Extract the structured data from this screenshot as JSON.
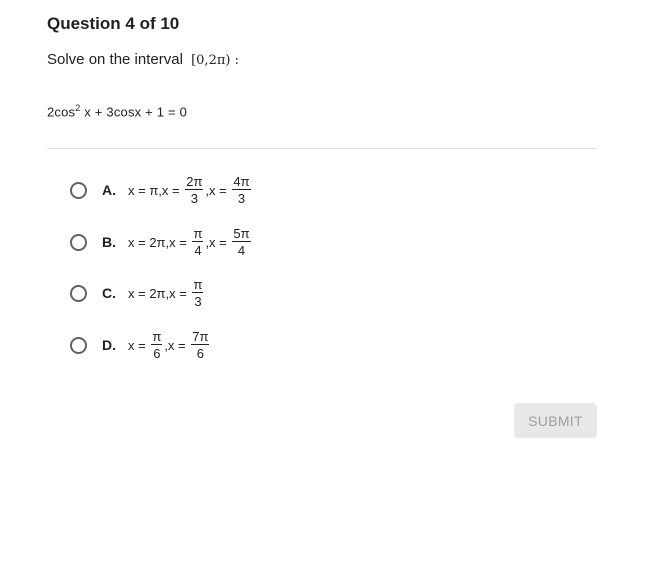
{
  "header": {
    "title": "Question 4 of 10"
  },
  "question": {
    "prompt": "Solve on the interval",
    "interval": "[0,2π) :",
    "equation_part1": "2cos",
    "equation_exp": "2",
    "equation_part2": " x + 3cosx + 1 = 0"
  },
  "options": {
    "a": {
      "letter": "A.",
      "t1": "x = π,x = ",
      "f1_num": "2π",
      "f1_den": "3",
      "t2": ",x = ",
      "f2_num": "4π",
      "f2_den": "3"
    },
    "b": {
      "letter": "B.",
      "t1": "x = 2π,x = ",
      "f1_num": "π",
      "f1_den": "4",
      "t2": ",x = ",
      "f2_num": "5π",
      "f2_den": "4"
    },
    "c": {
      "letter": "C.",
      "t1": "x = 2π,x = ",
      "f1_num": "π",
      "f1_den": "3"
    },
    "d": {
      "letter": "D.",
      "t1": "x = ",
      "f1_num": "π",
      "f1_den": "6",
      "t2": ",x = ",
      "f2_num": "7π",
      "f2_den": "6"
    }
  },
  "submit": {
    "label": "SUBMIT"
  },
  "colors": {
    "radio_border": "#5f6368",
    "submit_bg": "#e8e8e8",
    "submit_text": "#9e9e9e",
    "divider": "#e0e0e0"
  }
}
